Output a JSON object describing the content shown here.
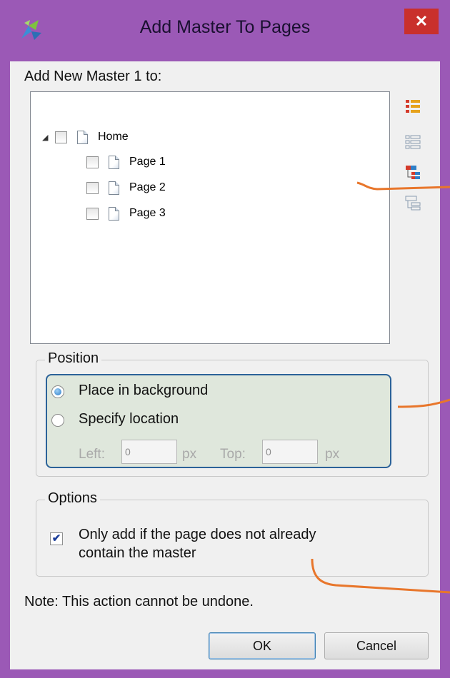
{
  "window": {
    "title": "Add Master To Pages",
    "close_label": "✕",
    "accent_color": "#9b59b6"
  },
  "tree": {
    "heading": "Add New Master 1 to:",
    "expander": "◢",
    "items": [
      {
        "label": "Home"
      },
      {
        "label": "Page 1"
      },
      {
        "label": "Page 2"
      },
      {
        "label": "Page 3"
      }
    ],
    "side_icons": [
      "check-all-icon",
      "uncheck-all-icon",
      "check-children-icon",
      "uncheck-children-icon"
    ]
  },
  "position": {
    "group_label": "Position",
    "option_background": "Place in background",
    "option_specify": "Specify location",
    "selected": "Place in background",
    "left_label": "Left:",
    "left_value": "0",
    "top_label": "Top:",
    "top_value": "0",
    "unit": "px"
  },
  "options": {
    "group_label": "Options",
    "only_add_line1": "Only add if the page does not already",
    "only_add_line2": "contain the master",
    "only_add_checked": true
  },
  "note": "Note: This action cannot be undone.",
  "buttons": {
    "ok": "OK",
    "cancel": "Cancel"
  },
  "colors": {
    "highlight_fill": "#dfe7dc",
    "highlight_border": "#2b6299",
    "callout": "#e8762b"
  }
}
